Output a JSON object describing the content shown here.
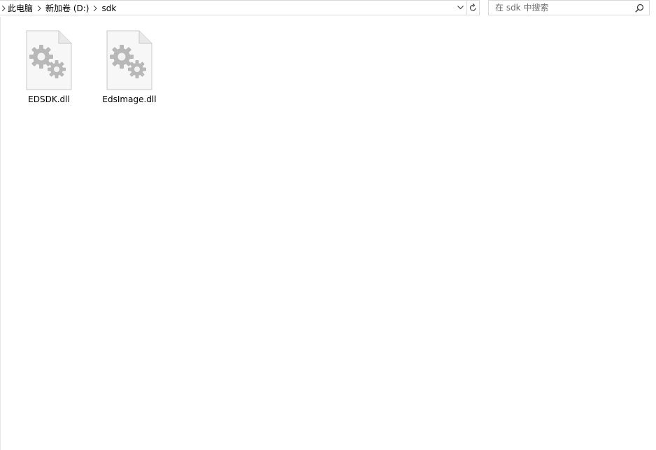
{
  "address_bar": {
    "breadcrumbs": [
      "此电脑",
      "新加卷 (D:)",
      "sdk"
    ]
  },
  "search": {
    "placeholder": "在 sdk 中搜索",
    "value": ""
  },
  "files": [
    {
      "name": "EDSDK.dll",
      "icon": "dll-file-icon"
    },
    {
      "name": "EdsImage.dll",
      "icon": "dll-file-icon"
    }
  ],
  "colors": {
    "border": "#d9d9d9",
    "background": "#ffffff",
    "icon_gray": "#b3b3b3"
  }
}
